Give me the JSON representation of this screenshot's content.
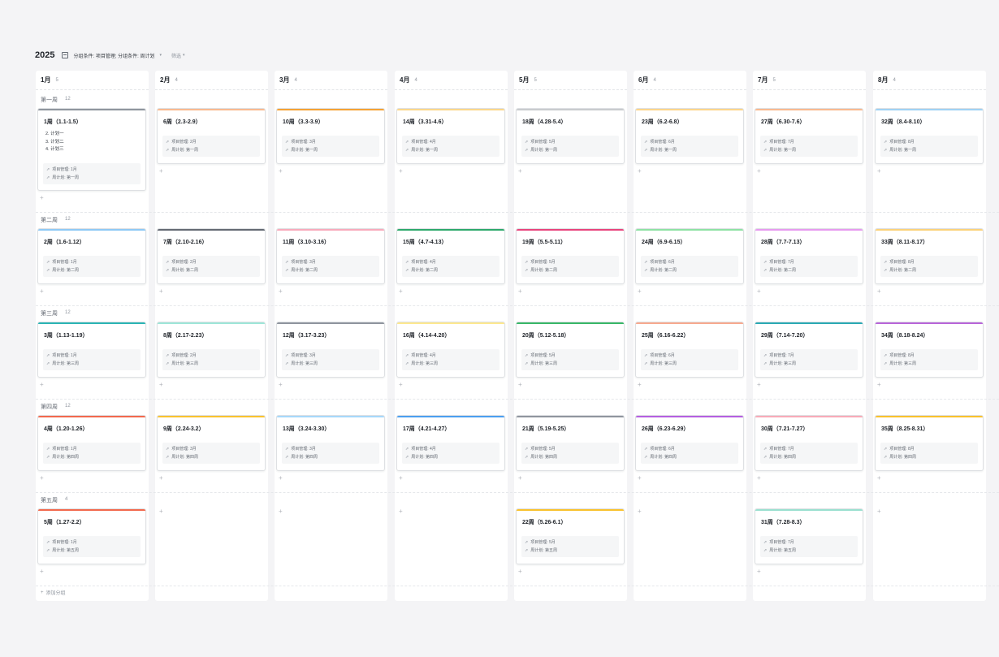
{
  "toolbar": {
    "year": "2025",
    "group_label": "分组条件: 项目管理; 分组条件: 周计划",
    "filter_label": "筛选"
  },
  "months": [
    {
      "label": "1月",
      "count": "5"
    },
    {
      "label": "2月",
      "count": "4"
    },
    {
      "label": "3月",
      "count": "4"
    },
    {
      "label": "4月",
      "count": "4"
    },
    {
      "label": "5月",
      "count": "5"
    },
    {
      "label": "6月",
      "count": "4"
    },
    {
      "label": "7月",
      "count": "5"
    },
    {
      "label": "8月",
      "count": "4"
    }
  ],
  "rows": [
    {
      "label": "第一周",
      "count": "12"
    },
    {
      "label": "第二周",
      "count": "12"
    },
    {
      "label": "第三周",
      "count": "12"
    },
    {
      "label": "第四周",
      "count": "12"
    },
    {
      "label": "第五周",
      "count": "4"
    }
  ],
  "first_card_items": [
    "2. 计划一",
    "3. 计划二",
    "4. 计划三"
  ],
  "cards": [
    {
      "col": 0,
      "row": 0,
      "title": "1周（1.1-1.5）",
      "color": "#8f959e",
      "field1": "项目管理: 1月",
      "field2": "周计划: 第一周"
    },
    {
      "col": 1,
      "row": 0,
      "title": "6周（2.3-2.9）",
      "color": "#f9b98f",
      "field1": "项目管理: 2月",
      "field2": "周计划: 第一周"
    },
    {
      "col": 2,
      "row": 0,
      "title": "10周（3.3-3.9）",
      "color": "#f5a234",
      "field1": "项目管理: 3月",
      "field2": "周计划: 第一周"
    },
    {
      "col": 3,
      "row": 0,
      "title": "14周（3.31-4.6）",
      "color": "#fbd78a",
      "field1": "项目管理: 4月",
      "field2": "周计划: 第一周"
    },
    {
      "col": 4,
      "row": 0,
      "title": "18周（4.28-5.4）",
      "color": "#c9cbce",
      "field1": "项目管理: 5月",
      "field2": "周计划: 第一周"
    },
    {
      "col": 5,
      "row": 0,
      "title": "23周（6.2-6.8）",
      "color": "#fcd58a",
      "field1": "项目管理: 6月",
      "field2": "周计划: 第一周"
    },
    {
      "col": 6,
      "row": 0,
      "title": "27周（6.30-7.6）",
      "color": "#f9b98f",
      "field1": "项目管理: 7月",
      "field2": "周计划: 第一周"
    },
    {
      "col": 7,
      "row": 0,
      "title": "32周（8.4-8.10）",
      "color": "#9fd2f4",
      "field1": "项目管理: 8月",
      "field2": "周计划: 第一周"
    },
    {
      "col": 0,
      "row": 1,
      "title": "2周（1.6-1.12）",
      "color": "#8fc9f5",
      "field1": "项目管理: 1月",
      "field2": "周计划: 第二周"
    },
    {
      "col": 1,
      "row": 1,
      "title": "7周（2.10-2.16）",
      "color": "#646a73",
      "field1": "项目管理: 2月",
      "field2": "周计划: 第二周"
    },
    {
      "col": 2,
      "row": 1,
      "title": "11周（3.10-3.16）",
      "color": "#f8aabc",
      "field1": "项目管理: 3月",
      "field2": "周计划: 第二周"
    },
    {
      "col": 3,
      "row": 1,
      "title": "15周（4.7-4.13）",
      "color": "#2ea96b",
      "field1": "项目管理: 4月",
      "field2": "周计划: 第二周"
    },
    {
      "col": 4,
      "row": 1,
      "title": "19周（5.5-5.11）",
      "color": "#e8457d",
      "field1": "项目管理: 5月",
      "field2": "周计划: 第二周"
    },
    {
      "col": 5,
      "row": 1,
      "title": "24周（6.9-6.15）",
      "color": "#8ee2a4",
      "field1": "项目管理: 6月",
      "field2": "周计划: 第二周"
    },
    {
      "col": 6,
      "row": 1,
      "title": "28周（7.7-7.13）",
      "color": "#e79af0",
      "field1": "项目管理: 7月",
      "field2": "周计划: 第二周"
    },
    {
      "col": 7,
      "row": 1,
      "title": "33周（8.11-8.17）",
      "color": "#fbd27a",
      "field1": "项目管理: 8月",
      "field2": "周计划: 第二周"
    },
    {
      "col": 0,
      "row": 2,
      "title": "3周（1.13-1.19）",
      "color": "#2bb5b5",
      "field1": "项目管理: 1月",
      "field2": "周计划: 第三周"
    },
    {
      "col": 1,
      "row": 2,
      "title": "8周（2.17-2.23）",
      "color": "#9ee6d8",
      "field1": "项目管理: 2月",
      "field2": "周计划: 第三周"
    },
    {
      "col": 2,
      "row": 2,
      "title": "12周（3.17-3.23）",
      "color": "#8f959e",
      "field1": "项目管理: 3月",
      "field2": "周计划: 第三周"
    },
    {
      "col": 3,
      "row": 2,
      "title": "16周（4.14-4.20）",
      "color": "#fde88f",
      "field1": "项目管理: 4月",
      "field2": "周计划: 第三周"
    },
    {
      "col": 4,
      "row": 2,
      "title": "20周（5.12-5.18）",
      "color": "#38b768",
      "field1": "项目管理: 5月",
      "field2": "周计划: 第三周"
    },
    {
      "col": 5,
      "row": 2,
      "title": "25周（6.16-6.22）",
      "color": "#f7a98f",
      "field1": "项目管理: 6月",
      "field2": "周计划: 第三周"
    },
    {
      "col": 6,
      "row": 2,
      "title": "29周（7.14-7.20）",
      "color": "#2aa9b4",
      "field1": "项目管理: 7月",
      "field2": "周计划: 第三周"
    },
    {
      "col": 7,
      "row": 2,
      "title": "34周（8.18-8.24）",
      "color": "#b865d9",
      "field1": "项目管理: 8月",
      "field2": "周计划: 第三周"
    },
    {
      "col": 0,
      "row": 3,
      "title": "4周（1.20-1.26）",
      "color": "#f2694d",
      "field1": "项目管理: 1月",
      "field2": "周计划: 第四周"
    },
    {
      "col": 1,
      "row": 3,
      "title": "9周（2.24-3.2）",
      "color": "#f9c32f",
      "field1": "项目管理: 3月",
      "field2": "周计划: 第四周"
    },
    {
      "col": 2,
      "row": 3,
      "title": "13周（3.24-3.30）",
      "color": "#a7d8fa",
      "field1": "项目管理: 3月",
      "field2": "周计划: 第四周"
    },
    {
      "col": 3,
      "row": 3,
      "title": "17周（4.21-4.27）",
      "color": "#4b9ff0",
      "field1": "项目管理: 4月",
      "field2": "周计划: 第四周"
    },
    {
      "col": 4,
      "row": 3,
      "title": "21周（5.19-5.25）",
      "color": "#8f959e",
      "field1": "项目管理: 5月",
      "field2": "周计划: 第四周"
    },
    {
      "col": 5,
      "row": 3,
      "title": "26周（6.23-6.29）",
      "color": "#b55fe0",
      "field1": "项目管理: 6月",
      "field2": "周计划: 第四周"
    },
    {
      "col": 6,
      "row": 3,
      "title": "30周（7.21-7.27）",
      "color": "#f8aab8",
      "field1": "项目管理: 7月",
      "field2": "周计划: 第四周"
    },
    {
      "col": 7,
      "row": 3,
      "title": "35周（8.25-8.31）",
      "color": "#f9c22c",
      "field1": "项目管理: 8月",
      "field2": "周计划: 第四周"
    },
    {
      "col": 0,
      "row": 4,
      "title": "5周（1.27-2.2）",
      "color": "#f2694d",
      "field1": "项目管理: 1月",
      "field2": "周计划: 第五周"
    },
    {
      "col": 4,
      "row": 4,
      "title": "22周（5.26-6.1）",
      "color": "#f9c22c",
      "field1": "项目管理: 5月",
      "field2": "周计划: 第五周"
    },
    {
      "col": 6,
      "row": 4,
      "title": "31周（7.28-8.3）",
      "color": "#9ae0d0",
      "field1": "项目管理: 7月",
      "field2": "周计划: 第五周"
    }
  ],
  "add_group_label": "添加分组"
}
